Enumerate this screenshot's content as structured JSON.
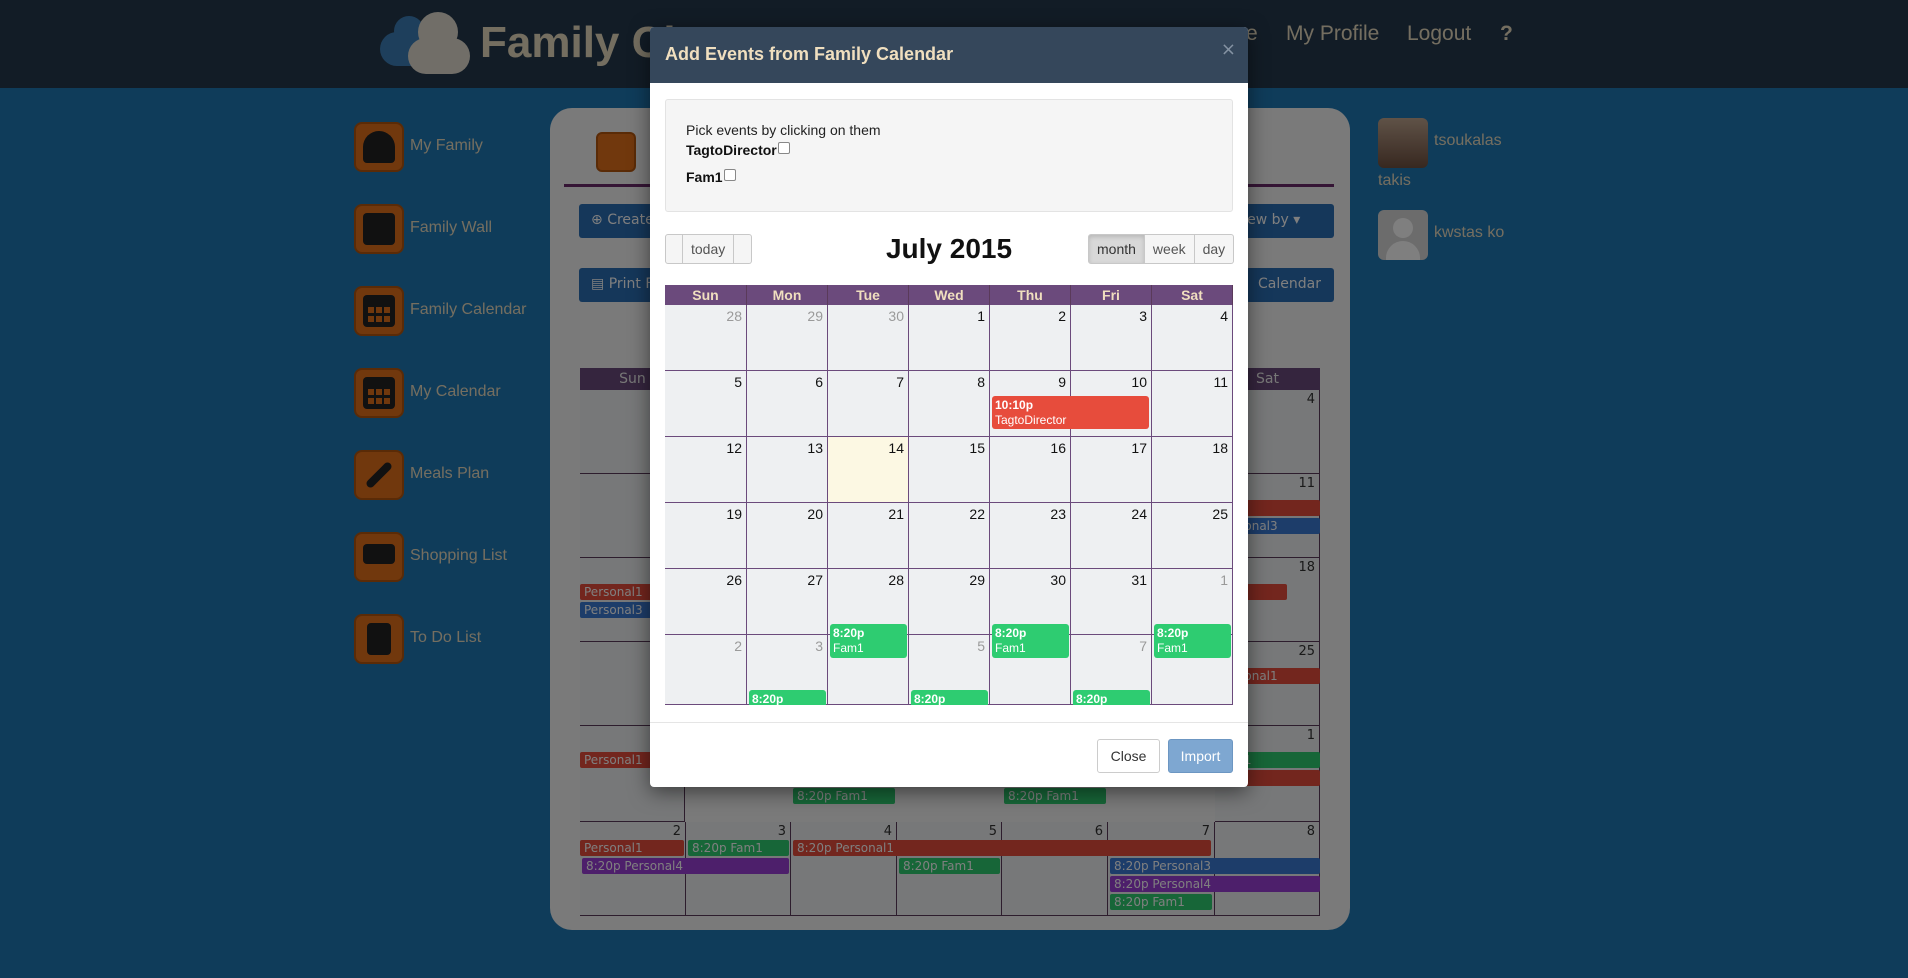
{
  "app": {
    "logo_text": "Family Cl",
    "nav": {
      "profile": "My Profile",
      "logout": "Logout",
      "help": "?",
      "partial_home": "e"
    }
  },
  "sidebar": {
    "items": [
      {
        "label": "My Family"
      },
      {
        "label": "Family Wall"
      },
      {
        "label": "Family Calendar"
      },
      {
        "label": "My Calendar"
      },
      {
        "label": "Meals Plan"
      },
      {
        "label": "Shopping List"
      },
      {
        "label": "To Do List"
      }
    ]
  },
  "panel": {
    "create_partial": "Create",
    "viewby": "View by ▾",
    "print_partial": "Print F",
    "calendar_partial": "Calendar",
    "bg_days": {
      "sun": "Sun",
      "sat": "Sat"
    },
    "bg_numbers": [
      "4",
      "11",
      "18",
      "25",
      "1",
      "2",
      "3",
      "4",
      "5",
      "6",
      "7",
      "8"
    ],
    "bg_events": {
      "personal1": "Personal1",
      "personal3": "Personal3",
      "time_fam1": "8:20p Fam1",
      "time_personal1": "8:20p Personal1",
      "time_personal3": "8:20p Personal3",
      "time_personal4": "8:20p Personal4",
      "fam1": "Fam1"
    }
  },
  "friends": [
    {
      "name": "tsoukalas",
      "sub": "takis"
    },
    {
      "name": "kwstas ko"
    }
  ],
  "modal": {
    "title": "Add Events from Family Calendar",
    "close_x": "×",
    "pick_hint": "Pick events by clicking on them",
    "sources": [
      "TagtoDirector",
      "Fam1"
    ],
    "today": "today",
    "month_title": "July 2015",
    "views": {
      "month": "month",
      "week": "week",
      "day": "day"
    },
    "dow": [
      "Sun",
      "Mon",
      "Tue",
      "Wed",
      "Thu",
      "Fri",
      "Sat"
    ],
    "weeks": [
      [
        "28",
        "29",
        "30",
        "1",
        "2",
        "3",
        "4"
      ],
      [
        "5",
        "6",
        "7",
        "8",
        "9",
        "10",
        "11"
      ],
      [
        "12",
        "13",
        "14",
        "15",
        "16",
        "17",
        "18"
      ],
      [
        "19",
        "20",
        "21",
        "22",
        "23",
        "24",
        "25"
      ],
      [
        "26",
        "27",
        "28",
        "29",
        "30",
        "31",
        "1"
      ],
      [
        "2",
        "3",
        "4",
        "5",
        "6",
        "7",
        "8"
      ]
    ],
    "events": {
      "tag_time": "10:10p",
      "tag_name": "TagtoDirector",
      "fam_time": "8:20p",
      "fam_name": "Fam1"
    },
    "close_btn": "Close",
    "import_btn": "Import"
  },
  "colors": {
    "red": "#e74c3c",
    "green": "#2ecc71",
    "blue": "#3a7bd5",
    "purple": "#9b3fd6",
    "header": "#6b4a7c"
  }
}
